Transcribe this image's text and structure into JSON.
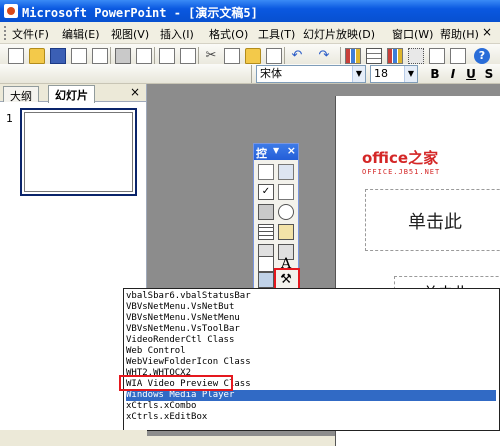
{
  "window": {
    "title": "Microsoft PowerPoint - [演示文稿5]"
  },
  "menubar": {
    "items": [
      {
        "label": "文件(F)"
      },
      {
        "label": "编辑(E)"
      },
      {
        "label": "视图(V)"
      },
      {
        "label": "插入(I)"
      },
      {
        "label": "格式(O)"
      },
      {
        "label": "工具(T)"
      },
      {
        "label": "幻灯片放映(D)"
      },
      {
        "label": "窗口(W)"
      },
      {
        "label": "帮助(H)"
      }
    ],
    "close_glyph": "×"
  },
  "formatting": {
    "font_name": "宋体",
    "font_size": "18",
    "bold": "B",
    "italic": "I",
    "underline": "U",
    "shadow": "S"
  },
  "pane": {
    "tabs": [
      {
        "label": "大纲"
      },
      {
        "label": "幻灯片"
      }
    ],
    "close_glyph": "×",
    "slide_number": "1"
  },
  "slide": {
    "title_placeholder": "单击此",
    "subtitle_placeholder": "单击此"
  },
  "watermark": {
    "line1": "office之家",
    "line2": "OFFICE.JB51.NET"
  },
  "toolbox": {
    "title": "控",
    "arrow": "▼",
    "close": "×"
  },
  "control_list": {
    "items": [
      "vbalSbar6.vbalStatusBar",
      "VBVsNetMenu.VsNetBut",
      "VBVsNetMenu.VsNetMenu",
      "VBVsNetMenu.VsToolBar",
      "VideoRenderCtl Class",
      "Web Control",
      "WebViewFolderIcon Class",
      "WHT2.WHTOCX2",
      "WIA Video Preview Class",
      "Windows Media Player",
      "xCtrls.xCombo",
      "xCtrls.xEditBox"
    ],
    "selected_index": 9
  },
  "colors": {
    "titlebar": "#0A58E0",
    "selection": "#316AC5",
    "highlight_red": "#E5181E",
    "watermark": "#D42626"
  }
}
